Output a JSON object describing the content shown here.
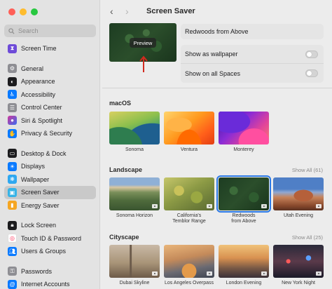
{
  "window": {
    "title": "Screen Saver",
    "nav_back": "‹",
    "nav_forward": "›"
  },
  "sidebar": {
    "search_placeholder": "Search",
    "items": [
      {
        "label": "Screen Time",
        "icon": "hourglass-icon",
        "color": "#6e4bd8"
      },
      {
        "label": "General",
        "icon": "gear-icon",
        "color": "#8e8e93"
      },
      {
        "label": "Appearance",
        "icon": "appearance-icon",
        "color": "#1c1c1e"
      },
      {
        "label": "Accessibility",
        "icon": "accessibility-icon",
        "color": "#0a7aff"
      },
      {
        "label": "Control Center",
        "icon": "control-center-icon",
        "color": "#8e8e93"
      },
      {
        "label": "Siri & Spotlight",
        "icon": "siri-icon",
        "color": "#d0389a"
      },
      {
        "label": "Privacy & Security",
        "icon": "hand-icon",
        "color": "#0a7aff"
      },
      {
        "label": "Desktop & Dock",
        "icon": "dock-icon",
        "color": "#1c1c1e"
      },
      {
        "label": "Displays",
        "icon": "displays-icon",
        "color": "#0a7aff"
      },
      {
        "label": "Wallpaper",
        "icon": "wallpaper-icon",
        "color": "#2fa8f0"
      },
      {
        "label": "Screen Saver",
        "icon": "screen-saver-icon",
        "color": "#37b3e6"
      },
      {
        "label": "Energy Saver",
        "icon": "battery-icon",
        "color": "#f5a623"
      },
      {
        "label": "Lock Screen",
        "icon": "lock-icon",
        "color": "#1c1c1e"
      },
      {
        "label": "Touch ID & Password",
        "icon": "fingerprint-icon",
        "color": "#ff375f"
      },
      {
        "label": "Users & Groups",
        "icon": "users-icon",
        "color": "#0a7aff"
      },
      {
        "label": "Passwords",
        "icon": "key-icon",
        "color": "#8e8e93"
      },
      {
        "label": "Internet Accounts",
        "icon": "at-icon",
        "color": "#0a7aff"
      }
    ]
  },
  "preview": {
    "button_label": "Preview",
    "selected_name": "Redwoods from Above"
  },
  "settings": {
    "wallpaper_label": "Show as wallpaper",
    "wallpaper_on": false,
    "spaces_label": "Show on all Spaces",
    "spaces_on": false
  },
  "sections": {
    "macos": {
      "title": "macOS",
      "items": [
        {
          "caption": "Sonoma"
        },
        {
          "caption": "Ventura"
        },
        {
          "caption": "Monterey"
        }
      ]
    },
    "landscape": {
      "title": "Landscape",
      "show_all": "Show All (61)",
      "items": [
        {
          "caption": "Sonoma Horizon"
        },
        {
          "caption": "California's\nTemblor Range"
        },
        {
          "caption": "Redwoods\nfrom Above",
          "selected": true
        },
        {
          "caption": "Utah Evening"
        }
      ]
    },
    "cityscape": {
      "title": "Cityscape",
      "show_all": "Show All (25)",
      "items": [
        {
          "caption": "Dubai Skyline"
        },
        {
          "caption": "Los Angeles Overpass"
        },
        {
          "caption": "London Evening"
        },
        {
          "caption": "New York Night"
        }
      ]
    }
  }
}
